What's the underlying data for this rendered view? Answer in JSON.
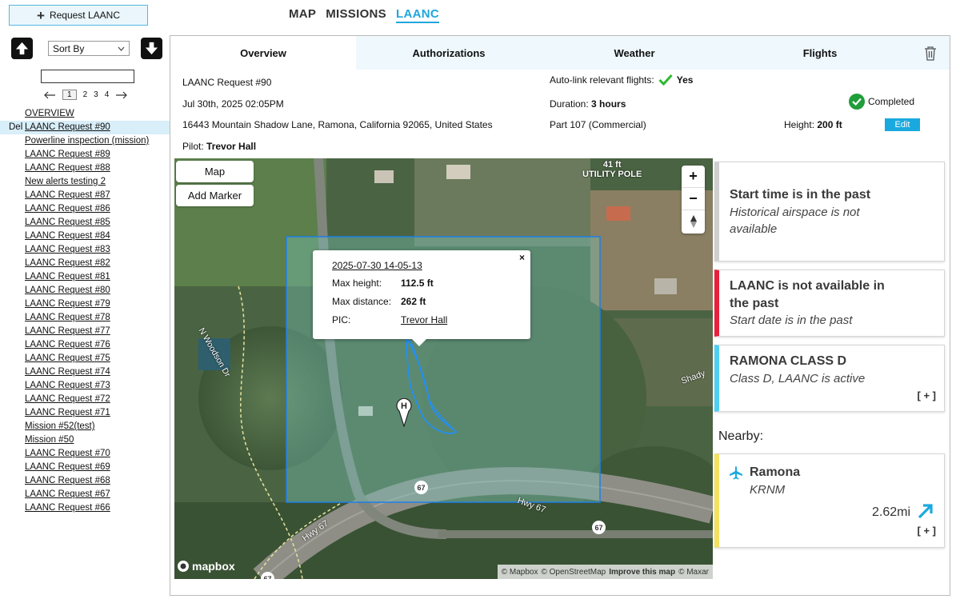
{
  "header": {
    "request_button": "Request LAANC",
    "nav": [
      "MAP",
      "MISSIONS",
      "LAANC"
    ],
    "nav_active": "LAANC"
  },
  "sidebar": {
    "sort_label": "Sort By",
    "pages": [
      "1",
      "2",
      "3",
      "4"
    ],
    "current_page": "1",
    "del_label": "Del",
    "items": [
      "OVERVIEW",
      "LAANC Request #90",
      "Powerline inspection (mission)",
      "LAANC Request #89",
      "LAANC Request #88",
      "New alerts testing 2",
      "LAANC Request #87",
      "LAANC Request #86",
      "LAANC Request #85",
      "LAANC Request #84",
      "LAANC Request #83",
      "LAANC Request #82",
      "LAANC Request #81",
      "LAANC Request #80",
      "LAANC Request #79",
      "LAANC Request #78",
      "LAANC Request #77",
      "LAANC Request #76",
      "LAANC Request #75",
      "LAANC Request #74",
      "LAANC Request #73",
      "LAANC Request #72",
      "LAANC Request #71",
      "Mission #52(test)",
      "Mission #50",
      "LAANC Request #70",
      "LAANC Request #69",
      "LAANC Request #68",
      "LAANC Request #67",
      "LAANC Request #66"
    ],
    "selected": "LAANC Request #90"
  },
  "tabs": [
    "Overview",
    "Authorizations",
    "Weather",
    "Flights"
  ],
  "active_tab": "Overview",
  "overview": {
    "request_title": "LAANC Request #90",
    "datetime": "Jul 30th, 2025 02:05PM",
    "address": "16443 Mountain Shadow Lane, Ramona, California 92065, United States",
    "pilot_label": "Pilot:",
    "pilot_name": "Trevor Hall",
    "autolink_label": "Auto-link relevant flights:",
    "autolink_value": "Yes",
    "duration_label": "Duration:",
    "duration_value": "3 hours",
    "part": "Part 107 (Commercial)",
    "status": "Completed",
    "height_label": "Height:",
    "height_value": "200 ft",
    "edit_label": "Edit"
  },
  "map": {
    "map_button": "Map",
    "add_marker_button": "Add Marker",
    "zoom_in": "+",
    "zoom_out": "−",
    "obstacle_height": "41 ft",
    "obstacle_name": "UTILITY POLE",
    "roads": [
      "N Woodson Dr",
      "Hwy 67",
      "Hwy 67",
      "Shady"
    ],
    "route_shields": [
      "67",
      "67",
      "67"
    ],
    "marker_letter": "H",
    "logo_text": "mapbox",
    "attribution": [
      "© Mapbox",
      "© OpenStreetMap",
      "Improve this map",
      "© Maxar"
    ],
    "popup": {
      "date": "2025-07-30 14-05-13",
      "max_height_label": "Max height:",
      "max_height_value": "112.5 ft",
      "max_distance_label": "Max distance:",
      "max_distance_value": "262 ft",
      "pic_label": "PIC:",
      "pic_value": "Trevor Hall",
      "close": "×"
    }
  },
  "alerts": [
    {
      "title": "Start time is in the past",
      "subtitle_lines": [
        "Historical airspace is not",
        "available"
      ],
      "color": "#cfcfcf"
    },
    {
      "title_lines": [
        "LAANC is not available in",
        "the past"
      ],
      "subtitle": "Start date is in the past",
      "color": "#e8203d"
    },
    {
      "title": "RAMONA CLASS D",
      "subtitle": "Class D, LAANC is active",
      "more": "[ + ]",
      "color": "#4fd0f0"
    }
  ],
  "nearby": {
    "label": "Nearby:",
    "airport_name": "Ramona",
    "airport_code": "KRNM",
    "distance": "2.62mi",
    "more": "[ + ]",
    "color": "#f4e160"
  },
  "colors": {
    "accent": "#20a6dc",
    "check_green": "#2eb82e",
    "status_green": "#1f9e3a",
    "track": "#1e90ff"
  }
}
